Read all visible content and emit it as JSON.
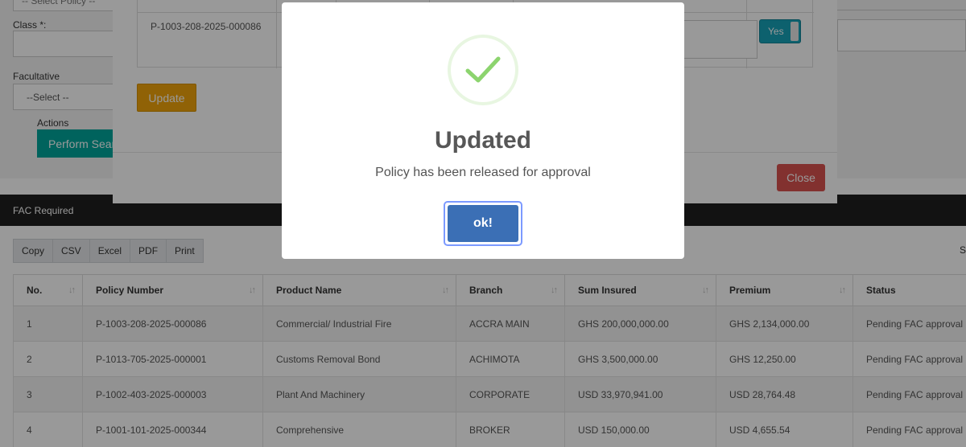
{
  "filters": {
    "top_select_value": "-- Select Policy --",
    "class_label": "Class *:",
    "facultative_label": "Facultative",
    "facultative_value": "--Select --",
    "actions_label": "Actions",
    "perform_search_label": "Perform Search"
  },
  "section_title": "FAC Required",
  "export_buttons": [
    "Copy",
    "CSV",
    "Excel",
    "PDF",
    "Print"
  ],
  "right_cut_text": "S",
  "table": {
    "columns": [
      "No.",
      "Policy Number",
      "Product Name",
      "Branch",
      "Sum Insured",
      "Premium",
      "Status"
    ],
    "rows": [
      {
        "no": "1",
        "policy": "P-1003-208-2025-000086",
        "product": "Commercial/ Industrial Fire",
        "branch": "ACCRA MAIN",
        "sum": "GHS 200,000,000.00",
        "premium": "GHS 2,134,000.00",
        "status": "Pending FAC approval"
      },
      {
        "no": "2",
        "policy": "P-1013-705-2025-000001",
        "product": "Customs Removal Bond",
        "branch": "ACHIMOTA",
        "sum": "GHS 3,500,000.00",
        "premium": "GHS 12,250.00",
        "status": "Pending FAC approval"
      },
      {
        "no": "3",
        "policy": "P-1002-403-2025-000003",
        "product": "Plant And Machinery",
        "branch": "CORPORATE",
        "sum": "USD 33,970,941.00",
        "premium": "USD 28,764.48",
        "status": "Pending FAC approval"
      },
      {
        "no": "4",
        "policy": "P-1001-101-2025-000344",
        "product": "Comprehensive",
        "branch": "BROKER",
        "sum": "USD 150,000.00",
        "premium": "USD 4,655.54",
        "status": "Pending FAC approval"
      }
    ]
  },
  "modal": {
    "policy_number": "P-1003-208-2025-000086",
    "toggle_label": "Yes",
    "update_label": "Update",
    "close_label": "Close"
  },
  "alert": {
    "title": "Updated",
    "text": "Policy has been released for approval",
    "ok_label": "ok!",
    "icon": "success-check-icon",
    "icon_color": "#8cd46e",
    "button_color": "#3b6fb5"
  }
}
